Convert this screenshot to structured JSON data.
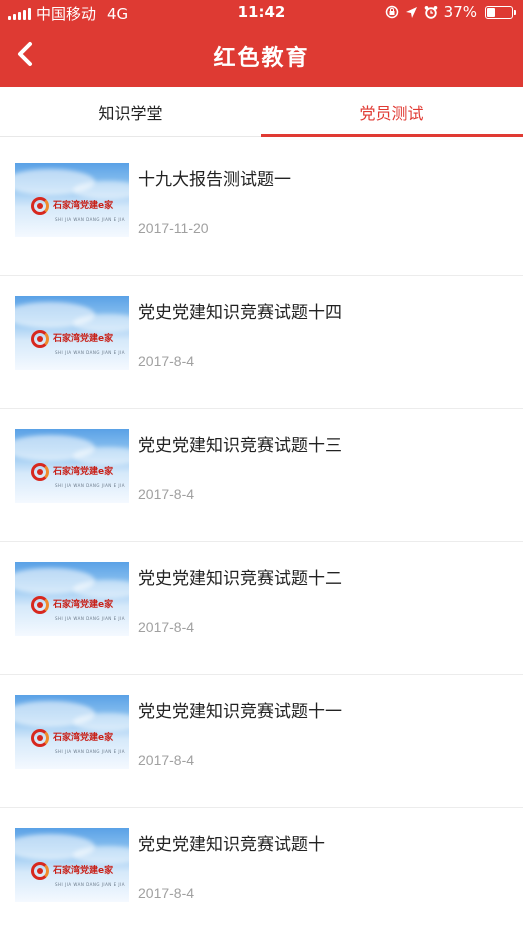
{
  "status_bar": {
    "carrier": "中国移动",
    "network": "4G",
    "time": "11:42",
    "battery_percent": "37%",
    "battery_level": 0.37
  },
  "header": {
    "title": "红色教育",
    "back_icon": "chevron-left-icon"
  },
  "tabs": [
    {
      "label": "知识学堂",
      "active": false
    },
    {
      "label": "党员测试",
      "active": true
    }
  ],
  "thumbnail_logo": {
    "text": "石家湾党建e家",
    "subtitle": "SHI JIA WAN DANG JIAN E JIA"
  },
  "items": [
    {
      "title": "十九大报告测试题一",
      "date": "2017-11-20"
    },
    {
      "title": "党史党建知识竞赛试题十四",
      "date": "2017-8-4"
    },
    {
      "title": "党史党建知识竞赛试题十三",
      "date": "2017-8-4"
    },
    {
      "title": "党史党建知识竞赛试题十二",
      "date": "2017-8-4"
    },
    {
      "title": "党史党建知识竞赛试题十一",
      "date": "2017-8-4"
    },
    {
      "title": "党史党建知识竞赛试题十",
      "date": "2017-8-4"
    }
  ],
  "colors": {
    "header_bg": "#de3a33",
    "accent": "#e03a33"
  }
}
